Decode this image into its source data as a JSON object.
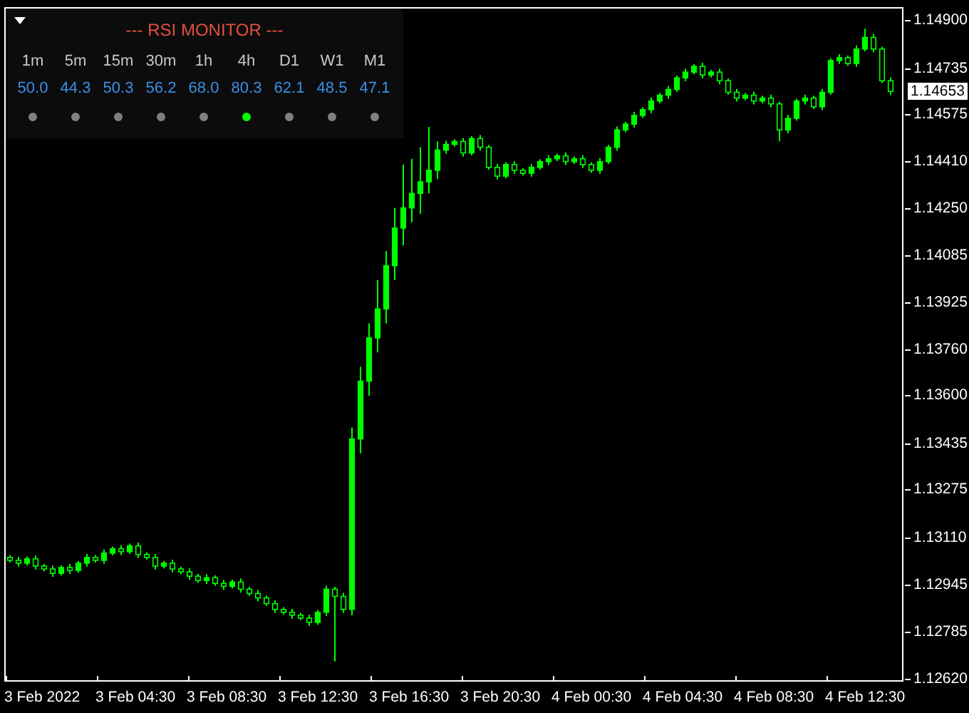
{
  "rsi_monitor": {
    "title": "--- RSI MONITOR ---",
    "timeframes": [
      {
        "label": "1m",
        "value": "50.0",
        "color": "#808080"
      },
      {
        "label": "5m",
        "value": "44.3",
        "color": "#808080"
      },
      {
        "label": "15m",
        "value": "50.3",
        "color": "#808080"
      },
      {
        "label": "30m",
        "value": "56.2",
        "color": "#808080"
      },
      {
        "label": "1h",
        "value": "68.0",
        "color": "#808080"
      },
      {
        "label": "4h",
        "value": "80.3",
        "color": "#00ff00"
      },
      {
        "label": "D1",
        "value": "62.1",
        "color": "#808080"
      },
      {
        "label": "W1",
        "value": "48.5",
        "color": "#808080"
      },
      {
        "label": "M1",
        "value": "47.1",
        "color": "#808080"
      }
    ]
  },
  "price_chart": {
    "current_price": "1.14653",
    "chart_data": {
      "type": "candlestick",
      "ylim": [
        1.1261,
        1.1494
      ],
      "yticks": [
        {
          "value": 1.149,
          "label": "1.14900"
        },
        {
          "value": 1.14735,
          "label": "1.14735"
        },
        {
          "value": 1.14575,
          "label": "1.14575"
        },
        {
          "value": 1.1441,
          "label": "1.14410"
        },
        {
          "value": 1.1425,
          "label": "1.14250"
        },
        {
          "value": 1.14085,
          "label": "1.14085"
        },
        {
          "value": 1.13925,
          "label": "1.13925"
        },
        {
          "value": 1.1376,
          "label": "1.13760"
        },
        {
          "value": 1.136,
          "label": "1.13600"
        },
        {
          "value": 1.13435,
          "label": "1.13435"
        },
        {
          "value": 1.13275,
          "label": "1.13275"
        },
        {
          "value": 1.1311,
          "label": "1.13110"
        },
        {
          "value": 1.12945,
          "label": "1.12945"
        },
        {
          "value": 1.12785,
          "label": "1.12785"
        },
        {
          "value": 1.1262,
          "label": "1.12620"
        }
      ],
      "series": [
        {
          "color": "#00ff00",
          "ohlc": [
            [
              1.1304,
              1.13048,
              1.13022,
              1.1303
            ],
            [
              1.1303,
              1.13042,
              1.13008,
              1.1302
            ],
            [
              1.1302,
              1.13043,
              1.13012,
              1.13035
            ],
            [
              1.13035,
              1.13047,
              1.12998,
              1.1301
            ],
            [
              1.1301,
              1.13018,
              1.12992,
              1.13
            ],
            [
              1.13,
              1.13012,
              1.12973,
              1.12985
            ],
            [
              1.12985,
              1.13013,
              1.12977,
              1.13005
            ],
            [
              1.13005,
              1.13017,
              1.12983,
              1.12995
            ],
            [
              1.12995,
              1.13028,
              1.12987,
              1.1302
            ],
            [
              1.1302,
              1.13052,
              1.13008,
              1.1304
            ],
            [
              1.1304,
              1.13048,
              1.13022,
              1.1303
            ],
            [
              1.1303,
              1.13067,
              1.13018,
              1.13055
            ],
            [
              1.13055,
              1.13078,
              1.13047,
              1.1307
            ],
            [
              1.1307,
              1.13082,
              1.13048,
              1.1306
            ],
            [
              1.1306,
              1.13088,
              1.13052,
              1.1308
            ],
            [
              1.1308,
              1.13092,
              1.13038,
              1.1305
            ],
            [
              1.1305,
              1.13058,
              1.13032,
              1.1304
            ],
            [
              1.1304,
              1.13052,
              1.12998,
              1.1301
            ],
            [
              1.1301,
              1.13028,
              1.13002,
              1.1302
            ],
            [
              1.1302,
              1.13032,
              1.12988,
              1.13
            ],
            [
              1.13,
              1.13008,
              1.12982,
              1.1299
            ],
            [
              1.1299,
              1.13002,
              1.12963,
              1.12975
            ],
            [
              1.12975,
              1.12983,
              1.12952,
              1.1296
            ],
            [
              1.1296,
              1.12982,
              1.12948,
              1.1297
            ],
            [
              1.1297,
              1.12978,
              1.12942,
              1.1295
            ],
            [
              1.1295,
              1.12962,
              1.12928,
              1.1294
            ],
            [
              1.1294,
              1.12963,
              1.12932,
              1.12955
            ],
            [
              1.12955,
              1.12967,
              1.12918,
              1.1293
            ],
            [
              1.1293,
              1.12938,
              1.12907,
              1.12915
            ],
            [
              1.12915,
              1.12927,
              1.12888,
              1.129
            ],
            [
              1.129,
              1.12908,
              1.12872,
              1.1288
            ],
            [
              1.1288,
              1.12892,
              1.12848,
              1.1286
            ],
            [
              1.1286,
              1.12868,
              1.12842,
              1.1285
            ],
            [
              1.1285,
              1.12862,
              1.12828,
              1.1284
            ],
            [
              1.1284,
              1.12848,
              1.12822,
              1.1283
            ],
            [
              1.1283,
              1.12842,
              1.12803,
              1.12815
            ],
            [
              1.12815,
              1.12858,
              1.12807,
              1.1285
            ],
            [
              1.1285,
              1.12942,
              1.12838,
              1.1293
            ],
            [
              1.1293,
              1.12938,
              1.1268,
              1.12905
            ],
            [
              1.12905,
              1.12917,
              1.12848,
              1.1286
            ],
            [
              1.1286,
              1.1349,
              1.1284,
              1.1345
            ],
            [
              1.1345,
              1.137,
              1.134,
              1.1365
            ],
            [
              1.1365,
              1.1385,
              1.136,
              1.138
            ],
            [
              1.138,
              1.14,
              1.1375,
              1.139
            ],
            [
              1.139,
              1.141,
              1.1385,
              1.1405
            ],
            [
              1.1405,
              1.1425,
              1.14,
              1.1418
            ],
            [
              1.1418,
              1.144,
              1.1412,
              1.1425
            ],
            [
              1.1425,
              1.1442,
              1.142,
              1.143
            ],
            [
              1.143,
              1.1446,
              1.1423,
              1.1434
            ],
            [
              1.1434,
              1.1453,
              1.143,
              1.1438
            ],
            [
              1.1438,
              1.1448,
              1.1435,
              1.1445
            ],
            [
              1.1445,
              1.14482,
              1.14438,
              1.1447
            ],
            [
              1.1447,
              1.14488,
              1.14462,
              1.1448
            ],
            [
              1.1448,
              1.14492,
              1.14428,
              1.1444
            ],
            [
              1.1444,
              1.14498,
              1.14432,
              1.1449
            ],
            [
              1.1449,
              1.14502,
              1.14448,
              1.1446
            ],
            [
              1.1446,
              1.14468,
              1.14382,
              1.1439
            ],
            [
              1.1439,
              1.14402,
              1.14348,
              1.1436
            ],
            [
              1.1436,
              1.14408,
              1.14352,
              1.144
            ],
            [
              1.144,
              1.14412,
              1.14368,
              1.1438
            ],
            [
              1.1438,
              1.14388,
              1.14362,
              1.1437
            ],
            [
              1.1437,
              1.14402,
              1.14358,
              1.1439
            ],
            [
              1.1439,
              1.14418,
              1.14382,
              1.1441
            ],
            [
              1.1441,
              1.14432,
              1.14398,
              1.1442
            ],
            [
              1.1442,
              1.14438,
              1.14412,
              1.1443
            ],
            [
              1.1443,
              1.14442,
              1.14398,
              1.1441
            ],
            [
              1.1441,
              1.14428,
              1.14402,
              1.1442
            ],
            [
              1.1442,
              1.14432,
              1.14388,
              1.144
            ],
            [
              1.144,
              1.14408,
              1.14372,
              1.1438
            ],
            [
              1.1438,
              1.14422,
              1.14368,
              1.1441
            ],
            [
              1.1441,
              1.14468,
              1.14402,
              1.1446
            ],
            [
              1.1446,
              1.14532,
              1.14448,
              1.1452
            ],
            [
              1.1452,
              1.14548,
              1.14512,
              1.1454
            ],
            [
              1.1454,
              1.14582,
              1.14528,
              1.1457
            ],
            [
              1.1457,
              1.14598,
              1.14562,
              1.1459
            ],
            [
              1.1459,
              1.14632,
              1.14578,
              1.1462
            ],
            [
              1.1462,
              1.14648,
              1.14612,
              1.1464
            ],
            [
              1.1464,
              1.14672,
              1.14628,
              1.1466
            ],
            [
              1.1466,
              1.14708,
              1.14652,
              1.147
            ],
            [
              1.147,
              1.14732,
              1.14688,
              1.1472
            ],
            [
              1.1472,
              1.14748,
              1.14712,
              1.1474
            ],
            [
              1.1474,
              1.14752,
              1.14698,
              1.1471
            ],
            [
              1.1471,
              1.14728,
              1.14702,
              1.1472
            ],
            [
              1.1472,
              1.14732,
              1.14678,
              1.1469
            ],
            [
              1.1469,
              1.14698,
              1.14642,
              1.1465
            ],
            [
              1.1465,
              1.14662,
              1.14618,
              1.1463
            ],
            [
              1.1463,
              1.14648,
              1.14622,
              1.1464
            ],
            [
              1.1464,
              1.14652,
              1.14608,
              1.1462
            ],
            [
              1.1462,
              1.14638,
              1.14612,
              1.1463
            ],
            [
              1.1463,
              1.14642,
              1.14598,
              1.1461
            ],
            [
              1.1461,
              1.14618,
              1.1448,
              1.1452
            ],
            [
              1.1452,
              1.14572,
              1.14508,
              1.1456
            ],
            [
              1.1456,
              1.14628,
              1.14552,
              1.1462
            ],
            [
              1.1462,
              1.14642,
              1.14608,
              1.1463
            ],
            [
              1.1463,
              1.14638,
              1.14592,
              1.146
            ],
            [
              1.146,
              1.14662,
              1.14588,
              1.1465
            ],
            [
              1.1465,
              1.14768,
              1.14642,
              1.1476
            ],
            [
              1.1476,
              1.14782,
              1.14748,
              1.1477
            ],
            [
              1.1477,
              1.14778,
              1.14742,
              1.1475
            ],
            [
              1.1475,
              1.14812,
              1.14738,
              1.148
            ],
            [
              1.148,
              1.1487,
              1.14792,
              1.1484
            ],
            [
              1.1484,
              1.14852,
              1.14788,
              1.148
            ],
            [
              1.148,
              1.14808,
              1.14682,
              1.1469
            ],
            [
              1.1469,
              1.14702,
              1.14641,
              1.14653
            ]
          ]
        }
      ]
    },
    "time_axis": {
      "labels": [
        "3 Feb 2022",
        "3 Feb 04:30",
        "3 Feb 08:30",
        "3 Feb 12:30",
        "3 Feb 16:30",
        "3 Feb 20:30",
        "4 Feb 00:30",
        "4 Feb 04:30",
        "4 Feb 08:30",
        "4 Feb 12:30"
      ]
    }
  }
}
